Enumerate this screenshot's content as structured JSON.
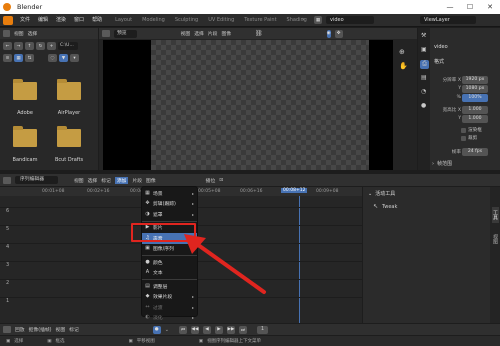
{
  "window": {
    "title": "Blender",
    "minimize": "—",
    "maximize": "☐",
    "close": "✕"
  },
  "menubar": {
    "menus": [
      "文件",
      "编辑",
      "渲染",
      "窗口",
      "帮助"
    ],
    "workspaces": [
      "Layout",
      "Modeling",
      "Sculpting",
      "UV Editing",
      "Texture Paint",
      "Shading"
    ],
    "scene_name": "video",
    "view_layer": "ViewLayer"
  },
  "file_browser": {
    "header_menus": [
      "视图",
      "选择"
    ],
    "path": "C:\\U...",
    "folders": [
      {
        "name": "Adobe"
      },
      {
        "name": "AirPlayer"
      },
      {
        "name": "Bandicam"
      },
      {
        "name": "Bcut Drafts"
      }
    ]
  },
  "preview": {
    "view_label": "预览",
    "menus": [
      "视图",
      "选择",
      "片段",
      "图像"
    ]
  },
  "properties": {
    "object_name": "video",
    "section_format": "格式",
    "resolution_label": "分辨率",
    "res_x_label": "X",
    "res_x": "1920 px",
    "res_y_label": "Y",
    "res_y": "1080 px",
    "percent_label": "%",
    "percent": "100%",
    "aspect_label": "宽高比",
    "aspect_x_label": "X",
    "aspect_x": "1.000",
    "aspect_y_label": "Y",
    "aspect_y": "1.000",
    "render_region": "渲染框",
    "crop": "裁剪",
    "fps_label": "帧率",
    "fps": "24 fps",
    "section_frame_range": "帧范围"
  },
  "sequencer": {
    "editor": "序列编辑器",
    "menus": [
      "视图",
      "选择",
      "标记",
      "添加",
      "片段",
      "图像"
    ],
    "pivot": "播位",
    "time_labels": [
      "00:01+08",
      "00:02+16",
      "00:04+00",
      "00:05+08",
      "00:06+16",
      "00:08+12",
      "00:09+08"
    ],
    "current_time": "00:08+12",
    "channels": [
      "6",
      "5",
      "4",
      "3",
      "2",
      "1"
    ]
  },
  "context_menu": {
    "items": [
      {
        "icon": "▦",
        "label": "场景",
        "submenu": "▸"
      },
      {
        "icon": "✥",
        "label": "剪辑(跟踪)",
        "submenu": "▸"
      },
      {
        "icon": "◑",
        "label": "遮罩",
        "submenu": "▸"
      },
      {
        "icon": "▶",
        "label": "影片"
      },
      {
        "icon": "♫",
        "label": "声音"
      },
      {
        "icon": "▣",
        "label": "图像/序列"
      },
      {
        "icon": "●",
        "label": "颜色"
      },
      {
        "icon": "A",
        "label": "文本"
      },
      {
        "icon": "▤",
        "label": "调整层"
      },
      {
        "icon": "◆",
        "label": "效果片段",
        "submenu": "▸"
      },
      {
        "icon": "↔",
        "label": "过渡",
        "submenu": "▸"
      },
      {
        "icon": "◐",
        "label": "淡化",
        "submenu": "▸"
      }
    ]
  },
  "sidebar": {
    "section": "活动工具",
    "tool": "Tweak",
    "tabs": [
      "工具",
      "视图"
    ]
  },
  "timeline": {
    "menus": [
      "回放",
      "抠像(插帧)",
      "视图",
      "标记"
    ],
    "frame": "1"
  },
  "statusbar": {
    "select": "选择",
    "box_select": "框选",
    "pan": "平移视图",
    "context": "视图序列编辑器上下文菜单"
  },
  "colors": {
    "accent": "#4772b3",
    "highlight_box": "#e0251f",
    "arrow": "#e0251f",
    "folder": "#c59c43",
    "playhead": "#4772b3"
  }
}
